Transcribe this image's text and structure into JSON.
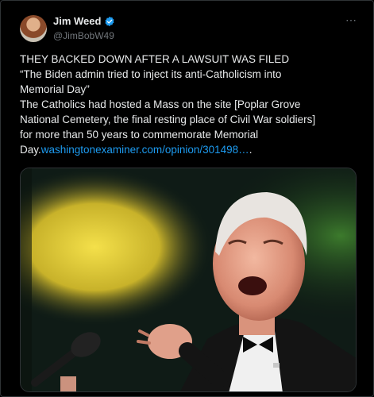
{
  "author": {
    "display_name": "Jim Weed",
    "handle": "@JimBobW49",
    "verified": true,
    "avatar_icon": "profile-photo"
  },
  "more_icon": "⋯",
  "post": {
    "lines": [
      "THEY BACKED DOWN AFTER A LAWSUIT WAS FILED",
      "“The Biden admin tried to inject its anti-Catholicism into",
      "Memorial Day”",
      "The Catholics had hosted a Mass on the site [Poplar Grove",
      "National Cemetery, the final resting place of Civil War soldiers]",
      "for more than 50 years to commemorate Memorial"
    ],
    "last_line_prefix": "Day.",
    "link_text": "washingtonexaminer.com/opinion/301498…",
    "last_line_suffix": "."
  },
  "media": {
    "description_icon": "photo-of-man-speaking-at-microphone"
  },
  "colors": {
    "background": "#000000",
    "text": "#e7e9ea",
    "secondary_text": "#71767b",
    "link": "#1d9bf0",
    "verified": "#1d9bf0"
  }
}
